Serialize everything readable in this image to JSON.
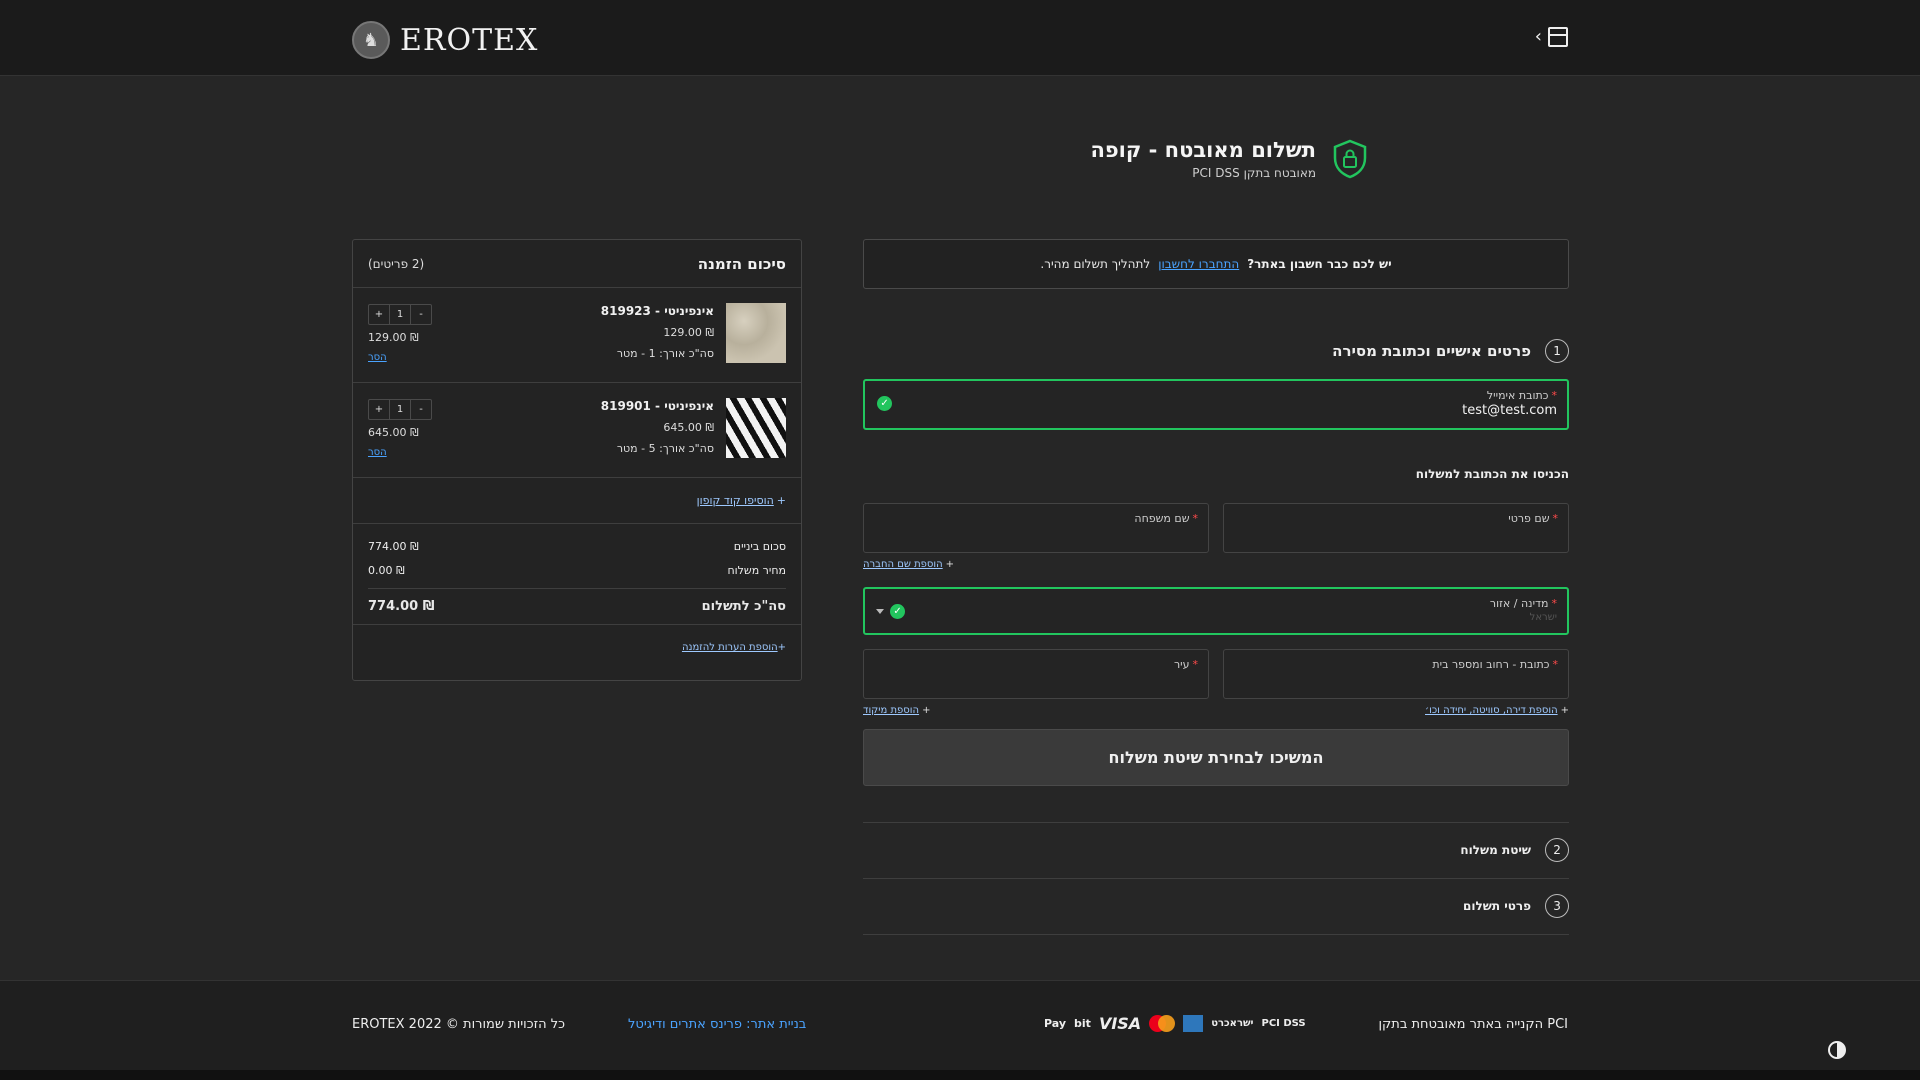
{
  "header": {
    "logo_text": "EROTEX",
    "back_arrow": "‹"
  },
  "page": {
    "title": "תשלום מאובטח - קופה",
    "subtitle": "מאובטח בתקן PCI DSS"
  },
  "login": {
    "question": "יש לכם כבר חשבון באתר?",
    "link": "התחברו לחשבון",
    "suffix": "לתהליך תשלום מהיר."
  },
  "step1": {
    "number": "1",
    "label": "פרטים אישיים וכתובת מסירה"
  },
  "email_field": {
    "label": "כתובת אימייל",
    "required": "*",
    "value": "test@test.com"
  },
  "address_section_label": "הכניסו את הכתובת למשלוח",
  "first_name": {
    "label": "שם פרטי",
    "required": "*"
  },
  "last_name": {
    "label": "שם משפחה",
    "required": "*"
  },
  "add_company": {
    "plus": "+",
    "link": "הוספת שם החברה"
  },
  "country": {
    "label": "מדינה / אזור",
    "required": "*",
    "value": "ישראל"
  },
  "street": {
    "label": "כתובת - רחוב ומספר בית",
    "required": "*"
  },
  "city": {
    "label": "עיר",
    "required": "*"
  },
  "add_apartment": {
    "plus": "+",
    "link": "הוספת דירה, סוויטה, יחידה וכו׳"
  },
  "add_zip": {
    "plus": "+",
    "link": "הוספת מיקוד"
  },
  "continue_button": "המשיכו לבחירת שיטת משלוח",
  "step2": {
    "number": "2",
    "label": "שיטת משלוח"
  },
  "step3": {
    "number": "3",
    "label": "פרטי תשלום"
  },
  "summary": {
    "title": "סיכום הזמנה",
    "count": "(2 פריטים)",
    "items": [
      {
        "name": "אינפיניטי - 819923",
        "price": "₪ 129.00",
        "length": "סה\"כ אורך: 1 - מטר",
        "qty": "1",
        "plus": "+",
        "minus": "-",
        "line_total": "₪ 129.00",
        "remove": "הסר"
      },
      {
        "name": "אינפיניטי - 819901",
        "price": "₪ 645.00",
        "length": "סה\"כ אורך: 5 - מטר",
        "qty": "1",
        "plus": "+",
        "minus": "-",
        "line_total": "₪ 645.00",
        "remove": "הסר"
      }
    ],
    "coupon_plus": "+",
    "coupon_link": "הוסיפו קוד קופון",
    "subtotal_label": "סכום ביניים",
    "subtotal_value": "₪ 774.00",
    "shipping_label": "מחיר משלוח",
    "shipping_value": "₪ 0.00",
    "total_label": "סה\"כ לתשלום",
    "total_value": "₪ 774.00",
    "notes_plus": "+",
    "notes_link": "הוספת הערות להזמנה"
  },
  "footer": {
    "pci_text": "הקנייה באתר מאובטחת בתקן PCI",
    "payment_logos": [
      "Pay",
      "bit",
      "VISA",
      "ישראכרט",
      "PCI DSS"
    ],
    "built_by": "בניית אתר: פרינס אתרים ודיגיטל",
    "copyright": "כל הזכויות שמורות © EROTEX 2022"
  },
  "colors": {
    "accent_green": "#22c55e",
    "link_blue": "#4aa3ff",
    "background": "#262626"
  }
}
